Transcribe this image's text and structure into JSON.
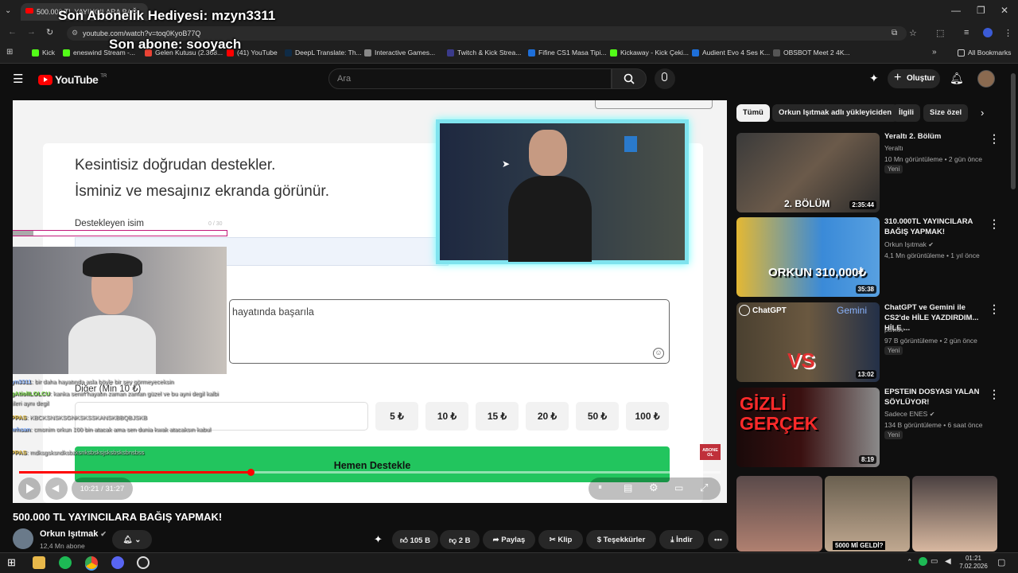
{
  "browser": {
    "tab_title": "500.000 TL YAYINCILARA BAĞ...",
    "url": "youtube.com/watch?v=toq0KyoB77Q",
    "bookmarks": [
      "Kick",
      "eneswind Stream -...",
      "Gelen Kutusu (2.368...",
      "(41) YouTube",
      "DeepL Translate: Th...",
      "Interactive Games...",
      "Twitch & Kick Strea...",
      "Fifine CS1 Masa Tipi...",
      "Kickaway - Kick Çeki...",
      "Audient Evo 4 Ses K...",
      "OBSBOT Meet 2 4K..."
    ],
    "all_bookmarks": "All Bookmarks"
  },
  "stream_overlay": {
    "last_gift": "Son Abonelik Hediyesi: mzyn3311",
    "last_sub": "Son abone: sooyach"
  },
  "youtube": {
    "logo": "YouTube",
    "logo_sup": "TR",
    "search_placeholder": "Ara",
    "create": "Oluştur"
  },
  "player": {
    "headline1": "Kesintisiz doğrudan destekler.",
    "headline2": "İsminiz ve mesajınız ekranda görünür.",
    "name_label": "Destekleyen isim",
    "name_counter": "0 / 30",
    "message_value": "hayatında başarıla",
    "other_label": "Diğer (Min 10 ₺)",
    "amounts": [
      "5 ₺",
      "10 ₺",
      "15 ₺",
      "20 ₺",
      "50 ₺",
      "100 ₺"
    ],
    "support_button": "Hemen Destekle",
    "abone_badge": "ABONE OL",
    "time": "10:21 / 31:27",
    "progress": 0.33
  },
  "chat": [
    {
      "user": "mzyn3311",
      "msg": ": bir daha hayatında asla böyle bir şey görmeyeceksin"
    },
    {
      "user": "CagAtiolILOLCU",
      "msg": ": kanka senin hayatın zaman zaman güzel ve bu ayni degil kalbi"
    },
    {
      "user": "",
      "msg": "çizgileri aynı degil"
    },
    {
      "user": "R1PPAS",
      "msg": ": KBCKSNSKSGNKSKSSKANSKBBQBJSKB"
    },
    {
      "user": "mthrhsan",
      "msg": ": cmonim orkun 100 bin atacak ama sen dunia kwak atacaksın kabul"
    },
    {
      "user": "",
      "msg": "mü"
    },
    {
      "user": "R1PPAS",
      "msg": ": mdksgsksndksbzksnksbsksjsksbsksbnsbss"
    }
  ],
  "video": {
    "title": "500.000 TL YAYINCILARA BAĞIŞ YAPMAK!",
    "channel": "Orkun Işıtmak",
    "subs": "12,4 Mn abone",
    "likes": "105 B",
    "dislikes": "2 B",
    "share": "Paylaş",
    "clip": "Klip",
    "thanks": "Teşekkürler",
    "download": "İndir"
  },
  "sidebar": {
    "chips": [
      "Tümü",
      "Orkun Işıtmak adlı yükleyiciden",
      "İlgili",
      "Size özel"
    ],
    "items": [
      {
        "title": "Yeraltı 2. Bölüm",
        "channel": "Yeraltı",
        "meta": "10 Mn görüntüleme • 2 gün önce",
        "badge": "Yeni",
        "duration": "2:35:44",
        "thumb_text": "2. BÖLÜM"
      },
      {
        "title": "310.000TL YAYINCILARA BAĞIŞ YAPMAK!",
        "channel": "Orkun Işıtmak",
        "meta": "4,1 Mn görüntüleme • 1 yıl önce",
        "badge": "",
        "duration": "35:38",
        "thumb_text": "ORKUN 310,000₺"
      },
      {
        "title": "ChatGPT ve Gemini ile CS2'de HİLE YAZDIRDIM... HİLE ...",
        "channel": "paviov",
        "meta": "97 B görüntüleme • 2 gün önce",
        "badge": "Yeni",
        "duration": "13:02",
        "thumb_text": "VS"
      },
      {
        "title": "EPSTEIN DOSYASI YALAN SÖYLÜYOR!",
        "channel": "Sadece ENES",
        "meta": "134 B görüntüleme • 6 saat önce",
        "badge": "Yeni",
        "duration": "8:19",
        "thumb_text": "GİZLİ GERÇEK"
      }
    ],
    "bottom_thumb_text": "5000 Mİ GELDİ?"
  },
  "taskbar": {
    "time": "01:21",
    "date": "7.02.2026"
  },
  "colors": {
    "accent_green": "#22c55e",
    "progress_red": "#ff0000",
    "cam_glow": "#7fe3ee"
  }
}
